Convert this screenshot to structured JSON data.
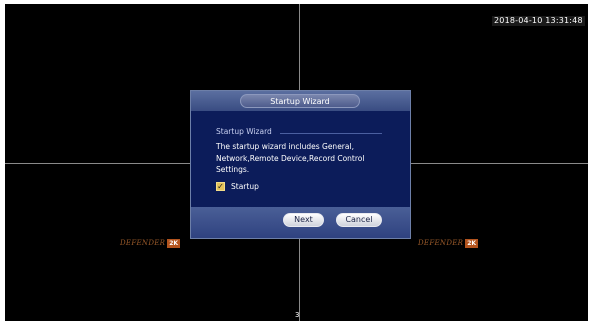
{
  "overlay": {
    "timestamp": "2018-04-10 13:31:48",
    "watermark_text": "DEFENDER",
    "watermark_badge": "2K",
    "channel": "3"
  },
  "dialog": {
    "title": "Startup Wizard",
    "section_title": "Startup Wizard",
    "description": "The startup wizard includes General, Network,Remote Device,Record Control Settings.",
    "checkbox_label": "Startup",
    "checkbox_checked": true,
    "next_label": "Next",
    "cancel_label": "Cancel"
  },
  "colors": {
    "dialog_bg": "#0c1c5a",
    "header_bg": "#4a5e95",
    "checkbox": "#e4c25a"
  }
}
